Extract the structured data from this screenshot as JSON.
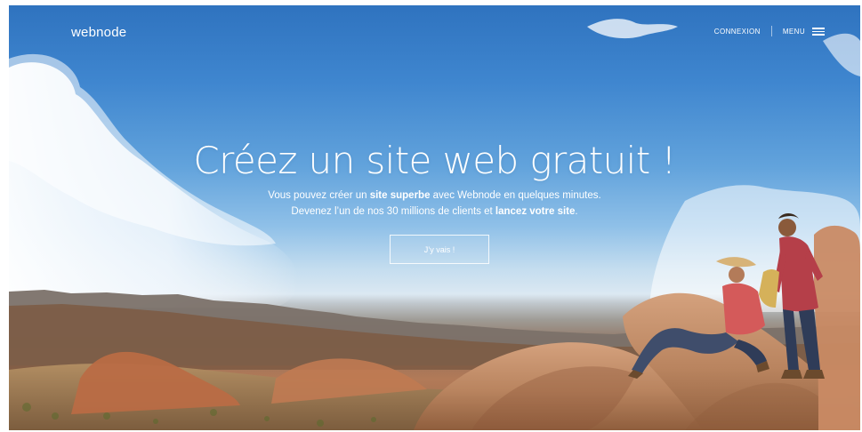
{
  "header": {
    "logo_text": "webnode",
    "nav": {
      "login_label": "CONNEXION",
      "menu_label": "MENU"
    }
  },
  "hero": {
    "title": "Créez un site web gratuit !",
    "subtitle_line1_part1": "Vous pouvez créer un ",
    "subtitle_line1_bold": "site superbe",
    "subtitle_line1_part2": " avec Webnode en quelques minutes.",
    "subtitle_line2_part1": "Devenez l’un de nos 30 millions de clients et ",
    "subtitle_line2_bold": "lancez votre site",
    "subtitle_line2_part2": ".",
    "cta_label": "J’y vais !"
  },
  "icons": {
    "menu_icon": "hamburger-menu-icon"
  },
  "colors": {
    "sky_top": "#2f73bf",
    "sky_mid": "#62a3dc",
    "text_white": "#ffffff",
    "rock": "#b27a58"
  }
}
